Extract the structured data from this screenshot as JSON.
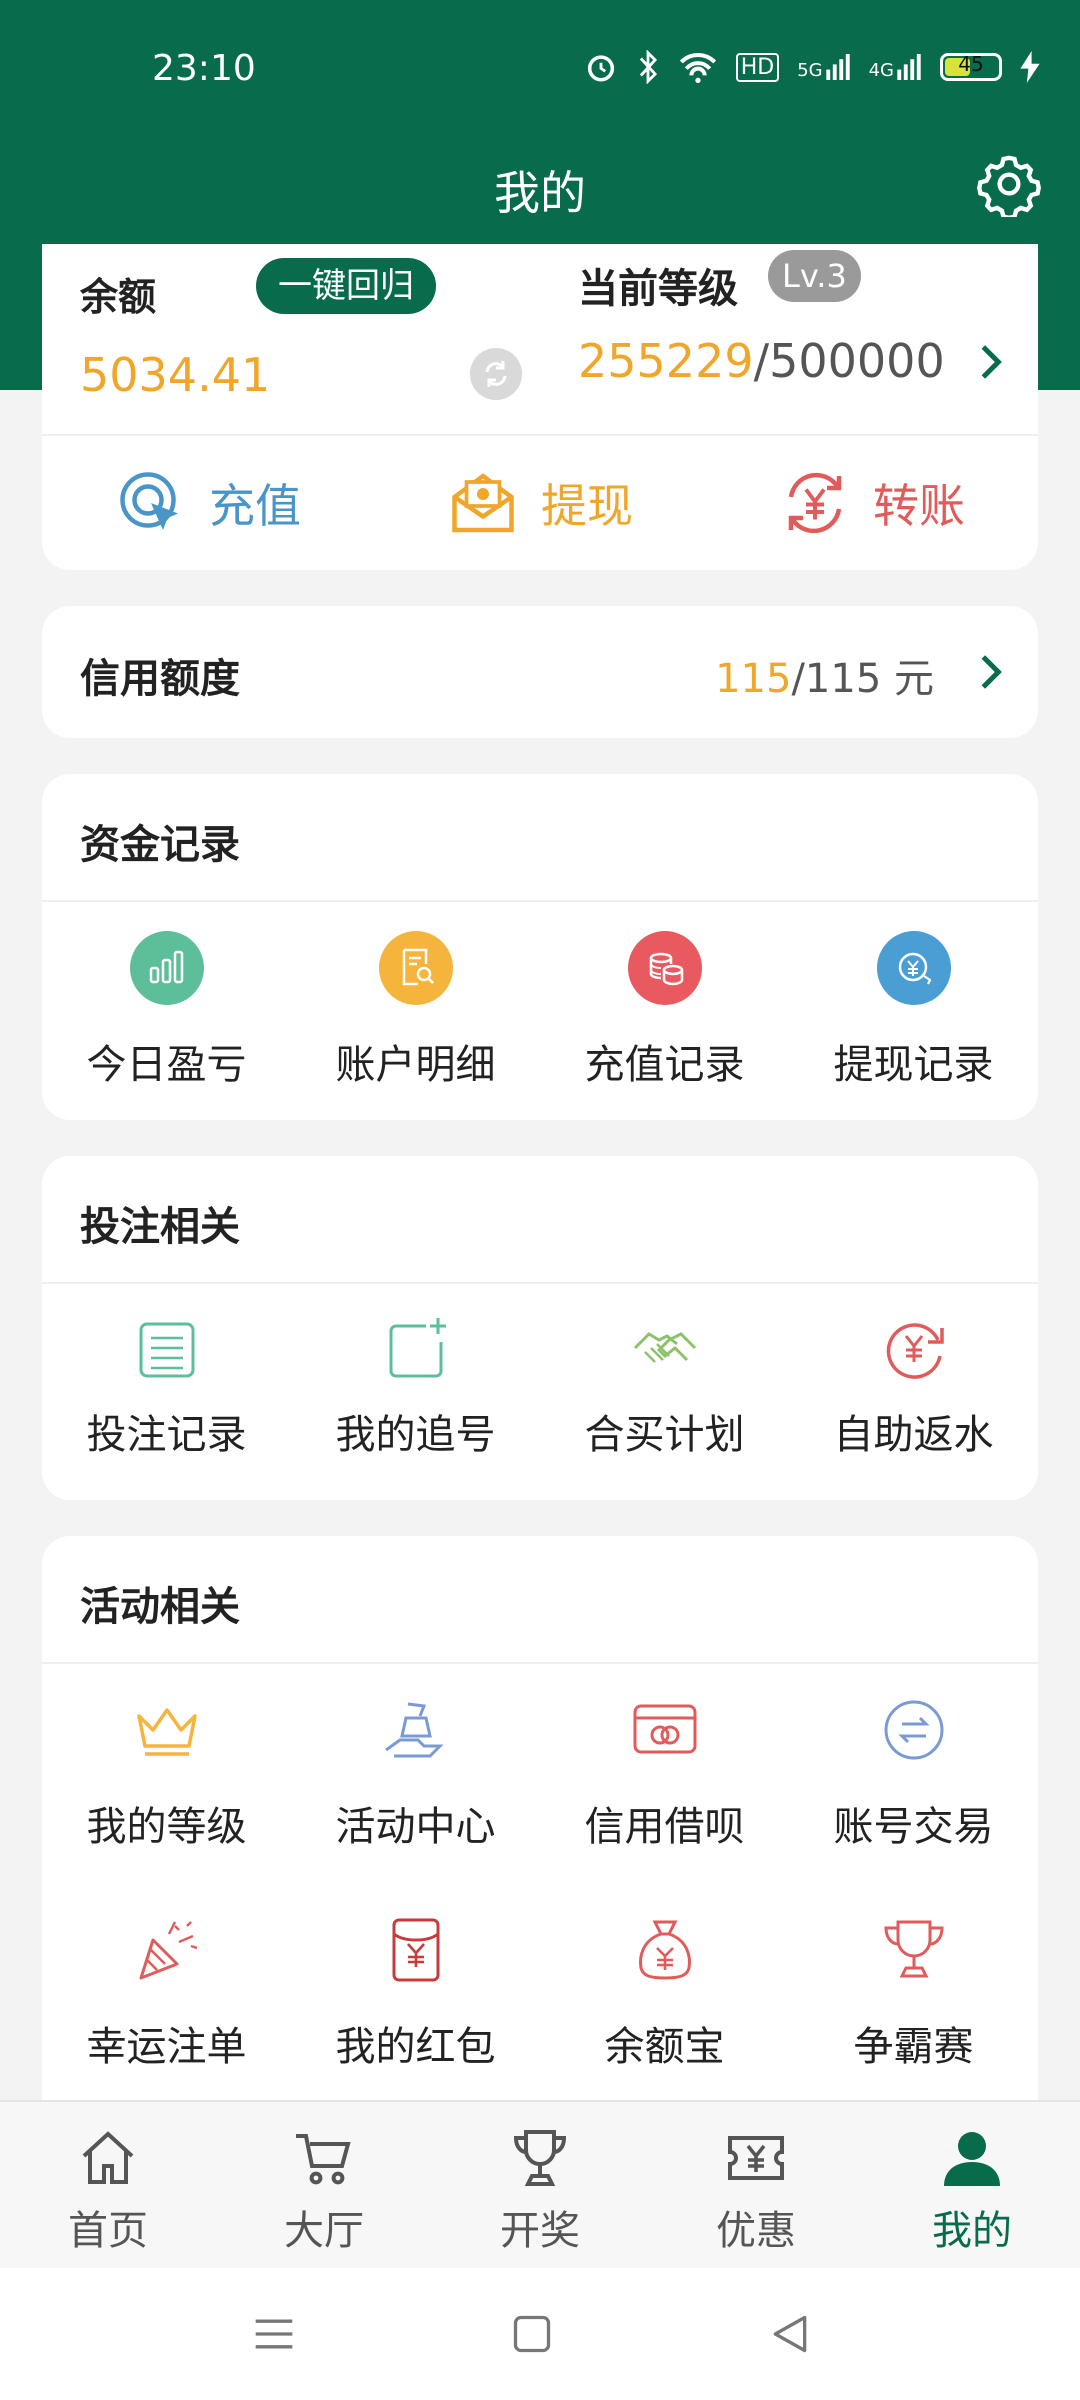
{
  "status_bar": {
    "time": "23:10",
    "hd": "HD",
    "net1": "5G",
    "net2": "4G",
    "battery": "45"
  },
  "header": {
    "title": "我的"
  },
  "balance": {
    "label": "余额",
    "reset_button": "一键回归",
    "value": "5034.41",
    "level_label": "当前等级",
    "level_badge": "Lv.3",
    "exp_current": "255229",
    "exp_rest": "/500000"
  },
  "quick_actions": [
    {
      "label": "充值",
      "icon": "recharge-icon",
      "color": "#4a95c8"
    },
    {
      "label": "提现",
      "icon": "withdraw-icon",
      "color": "#f0a62a"
    },
    {
      "label": "转账",
      "icon": "transfer-icon",
      "color": "#e25b5b"
    }
  ],
  "credit": {
    "label": "信用额度",
    "current": "115",
    "rest": "/115 元"
  },
  "funds": {
    "title": "资金记录",
    "items": [
      {
        "label": "今日盈亏",
        "icon": "chart-icon",
        "color": "#5cbf9a"
      },
      {
        "label": "账户明细",
        "icon": "statement-icon",
        "color": "#f5b43c"
      },
      {
        "label": "充值记录",
        "icon": "coins-icon",
        "color": "#e85a5f"
      },
      {
        "label": "提现记录",
        "icon": "yuan-circle-icon",
        "color": "#4a9ed4"
      }
    ]
  },
  "bets": {
    "title": "投注相关",
    "items": [
      {
        "label": "投注记录",
        "icon": "list-icon"
      },
      {
        "label": "我的追号",
        "icon": "add-note-icon"
      },
      {
        "label": "合买计划",
        "icon": "handshake-icon"
      },
      {
        "label": "自助返水",
        "icon": "rebate-icon"
      }
    ]
  },
  "activities": {
    "title": "活动相关",
    "items": [
      {
        "label": "我的等级",
        "icon": "crown-icon"
      },
      {
        "label": "活动中心",
        "icon": "gift-hand-icon"
      },
      {
        "label": "信用借呗",
        "icon": "card-icon"
      },
      {
        "label": "账号交易",
        "icon": "exchange-icon"
      },
      {
        "label": "幸运注单",
        "icon": "party-popper-icon"
      },
      {
        "label": "我的红包",
        "icon": "red-envelope-icon"
      },
      {
        "label": "余额宝",
        "icon": "money-bag-icon"
      },
      {
        "label": "争霸赛",
        "icon": "trophy-icon"
      }
    ]
  },
  "bottom_nav": [
    {
      "label": "首页",
      "icon": "home-icon",
      "active": false
    },
    {
      "label": "大厅",
      "icon": "cart-icon",
      "active": false
    },
    {
      "label": "开奖",
      "icon": "trophy-icon",
      "active": false
    },
    {
      "label": "优惠",
      "icon": "coupon-icon",
      "active": false
    },
    {
      "label": "我的",
      "icon": "user-icon",
      "active": true
    }
  ],
  "colors": {
    "brand": "#076b4c",
    "accent": "#f0a62a"
  }
}
